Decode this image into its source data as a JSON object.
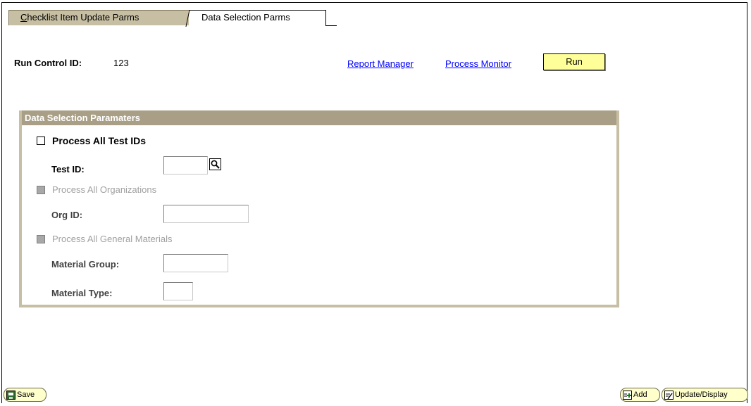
{
  "tabs": [
    {
      "label": "Checklist Item Update Parms",
      "access_key": "C",
      "rest": "hecklist Item Update Parms",
      "active": false
    },
    {
      "label": "Data Selection Parms",
      "active": true
    }
  ],
  "run_control": {
    "label": "Run Control ID:",
    "value": "123"
  },
  "links": {
    "report_manager": "Report Manager",
    "process_monitor": "Process Monitor"
  },
  "run_button": "Run",
  "group": {
    "title": "Data Selection Paramaters",
    "process_all_test_ids": {
      "label": "Process All Test IDs",
      "checked": false,
      "enabled": true
    },
    "test_id": {
      "label": "Test ID:",
      "value": ""
    },
    "process_all_orgs": {
      "label": "Process All Organizations",
      "checked": false,
      "enabled": false
    },
    "org_id": {
      "label": "Org ID:",
      "value": ""
    },
    "process_all_materials": {
      "label": "Process All General Materials",
      "checked": false,
      "enabled": false
    },
    "material_group": {
      "label": "Material Group:",
      "value": ""
    },
    "material_type": {
      "label": "Material Type:",
      "value": ""
    }
  },
  "footer": {
    "save": "Save",
    "add": "Add",
    "update_display": "Update/Display"
  },
  "colors": {
    "tab_inactive": "#c7bfa3",
    "group_header": "#a99f86",
    "run_button": "#ffff99",
    "link": "#0000ff"
  }
}
